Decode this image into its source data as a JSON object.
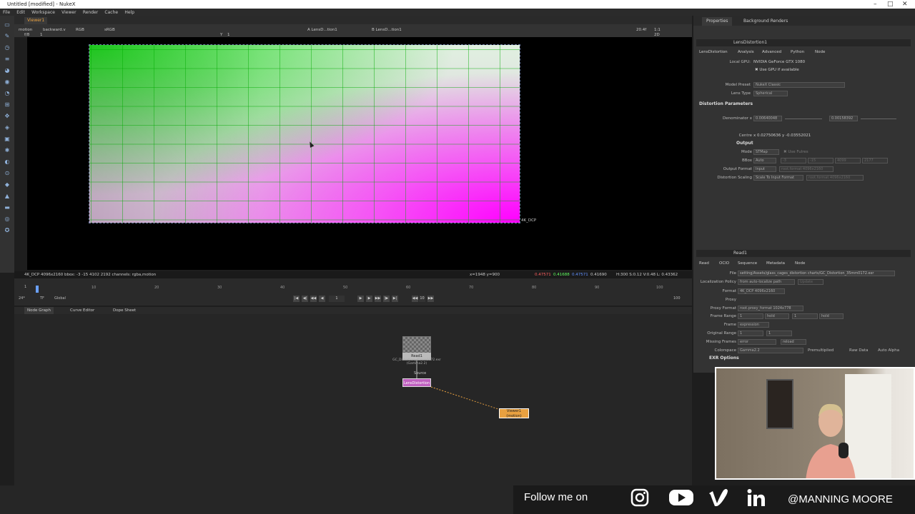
{
  "window": {
    "title": "Untitled [modified] - NukeX"
  },
  "menu": [
    "File",
    "Edit",
    "Workspace",
    "Viewer",
    "Render",
    "Cache",
    "Help"
  ],
  "viewer": {
    "tab": "Viewer1",
    "channels": "motion",
    "direction": "backward.v",
    "colorspace_mode": "RGB",
    "lut": "sRGB",
    "input_a": "A  LensD...tion1",
    "input_b": "B  LensD...tion1",
    "gain_label": "f/8",
    "gain_value": "1",
    "gamma_label": "Y",
    "gamma_value": "1",
    "zoom": "20.4f",
    "proxy": "1:1",
    "mode_2d": "2D",
    "format_label": "4K_DCP",
    "info_left": "4K_DCP 4096x2160  bbox: -3 -15 4102 2192 channels: rgba,motion",
    "info_xy": "x=1948 y=900",
    "info_r": "0.47571",
    "info_g": "0.41688",
    "info_b": "0.47571",
    "info_a": "0.41690",
    "info_hsv": "H:300 S:0.12 V:0.48  L: 0.43362"
  },
  "timeline": {
    "start": "1",
    "end": "100",
    "ticks": [
      "10",
      "20",
      "30",
      "40",
      "50",
      "60",
      "70",
      "80",
      "90",
      "100"
    ],
    "fps": "24*",
    "tf": "TF",
    "scope": "Global",
    "current": "1",
    "step": "10"
  },
  "graph_tabs": [
    "Node Graph",
    "Curve Editor",
    "Dope Sheet"
  ],
  "nodes": {
    "read": {
      "label": "Read1",
      "path": "GC_Distortion_35mm0172.exr",
      "sub": "(Gamma2.2)"
    },
    "lens": {
      "label": "LensDistortion",
      "input": "Source"
    },
    "viewer": {
      "label": "Viewer1",
      "sub": "(motion)"
    }
  },
  "properties": {
    "tabs": [
      "Properties",
      "Background Renders"
    ],
    "lens_panel": {
      "title": "LensDistortion1",
      "subtabs": [
        "LensDistortion",
        "Analysis",
        "Advanced",
        "Python",
        "Node"
      ],
      "local_gpu_label": "Local GPU:",
      "local_gpu": "NVIDIA GeForce GTX 1080",
      "use_gpu": "Use GPU if available",
      "model_preset_label": "Model Preset",
      "model_preset": "NukeX Classic",
      "lens_type_label": "Lens Type",
      "lens_type": "Spherical",
      "section_distortion": "Distortion Parameters",
      "denominator_label": "Denominator x",
      "denominator_x": "0.00640048",
      "denominator_y": "0.00158392",
      "centre_label": "Centre",
      "centre_value": "x 0.02750636  y -0.03552021",
      "section_output": "Output",
      "mode_label": "Mode",
      "mode": "STMap",
      "use_fulres": "Use Fulres",
      "bbox_label": "BBox",
      "bbox": "Auto",
      "bbox_vals": [
        "-3",
        "-15",
        "4099",
        "2177"
      ],
      "output_format_label": "Output Format",
      "output_format": "Input",
      "output_format_val": "root.format 4096x2160",
      "distortion_scaling_label": "Distortion Scaling",
      "distortion_scaling": "Scale To Input Format",
      "distortion_scaling_val": "root.format 4096x2160"
    },
    "read_panel": {
      "title": "Read1",
      "subtabs": [
        "Read",
        "OCIO",
        "Sequence",
        "Metadata",
        "Node"
      ],
      "file_label": "File",
      "file": "setting/Assets/glass_cages_distortion charts/GC_Distortion_35mm0172.exr",
      "localization_label": "Localization Policy",
      "localization": "from auto-localize path",
      "update": "Update",
      "format_label": "Format",
      "format": "4K_DCP 4096x2160",
      "proxy_label": "Proxy",
      "proxy_format_label": "Proxy Format",
      "proxy_format": "root.proxy_format 1024x778",
      "frame_range_label": "Frame Range",
      "frame_range_start": "1",
      "frame_range_end": "1",
      "hold1": "hold",
      "hold2": "hold",
      "frame_label": "Frame",
      "frame": "expression",
      "original_range_label": "Original Range",
      "original_range_start": "1",
      "original_range_end": "1",
      "missing_frames_label": "Missing Frames",
      "missing_frames": "error",
      "reload": "reload",
      "colorspace_label": "Colorspace",
      "colorspace": "Gamma2.2",
      "premultiplied": "Premultiplied",
      "raw_data": "Raw Data",
      "auto_alpha": "Auto Alpha",
      "exr_options": "EXR Options"
    }
  },
  "footer": {
    "follow": "Follow me on",
    "handle": "@MANNING MOORE",
    "icons": [
      "instagram-icon",
      "youtube-icon",
      "vimeo-icon",
      "linkedin-icon"
    ]
  }
}
